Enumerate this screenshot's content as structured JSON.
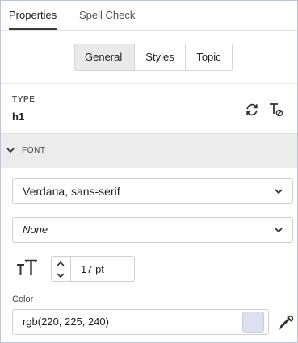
{
  "tabs": [
    {
      "label": "Properties",
      "active": true
    },
    {
      "label": "Spell Check",
      "active": false
    }
  ],
  "segments": [
    {
      "label": "General",
      "selected": true
    },
    {
      "label": "Styles",
      "selected": false
    },
    {
      "label": "Topic",
      "selected": false
    }
  ],
  "type": {
    "label": "TYPE",
    "value": "h1"
  },
  "font_section": {
    "title": "FONT",
    "expanded": true
  },
  "font_family": {
    "value": "Verdana, sans-serif"
  },
  "font_style": {
    "value": "None"
  },
  "font_size": {
    "value": "17 pt"
  },
  "color": {
    "label": "Color",
    "value": "rgb(220, 225, 240)",
    "swatch": "#dce1f0"
  },
  "icons": {
    "refresh": "refresh-icon",
    "clear_format": "clear-text-format-icon",
    "chevron": "chevron-down-icon",
    "font_size": "text-size-icon",
    "eyedropper": "eyedropper-icon"
  }
}
